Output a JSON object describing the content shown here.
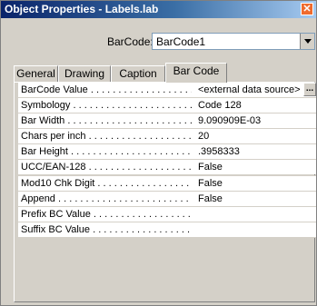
{
  "window": {
    "title": "Object Properties - Labels.lab",
    "close": "✕"
  },
  "barcode": {
    "label": "BarCode:",
    "selected": "BarCode1"
  },
  "tabs": [
    {
      "label": "General"
    },
    {
      "label": "Drawing"
    },
    {
      "label": "Caption"
    },
    {
      "label": "Bar Code"
    }
  ],
  "props": [
    {
      "key": "BarCode Value",
      "value": "<external data source>",
      "ellipsis": "..."
    },
    {
      "key": "Symbology",
      "value": "Code 128"
    },
    {
      "key": "Bar Width",
      "value": "9.090909E-03"
    },
    {
      "key": "Chars per inch",
      "value": "20"
    },
    {
      "key": "Bar Height",
      "value": ".3958333"
    },
    {
      "key": "UCC/EAN-128",
      "value": "False"
    },
    {
      "key": "Mod10 Chk Digit",
      "value": "False"
    },
    {
      "key": "Append",
      "value": "False"
    },
    {
      "key": "Prefix BC Value",
      "value": ""
    },
    {
      "key": "Suffix BC Value",
      "value": ""
    }
  ]
}
